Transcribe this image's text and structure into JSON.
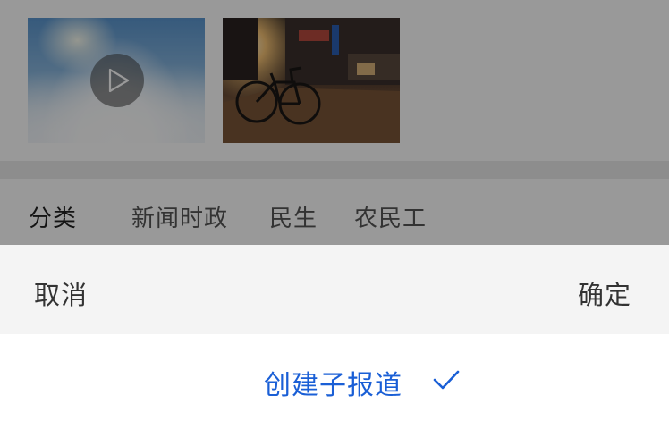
{
  "media": {
    "items": [
      {
        "type": "video",
        "icon": "play-icon"
      },
      {
        "type": "image",
        "icon": "bicycle-photo"
      }
    ]
  },
  "category": {
    "label": "分类",
    "tags": [
      "新闻时政",
      "民生",
      "农民工"
    ]
  },
  "sheet": {
    "cancel_label": "取消",
    "confirm_label": "确定",
    "options": [
      {
        "label": "创建子报道",
        "selected": true,
        "icon": "check-icon"
      }
    ]
  },
  "colors": {
    "accent": "#1a5fd6",
    "overlay": "rgba(0,0,0,0.4)",
    "sheet_header_bg": "#f4f4f4"
  }
}
